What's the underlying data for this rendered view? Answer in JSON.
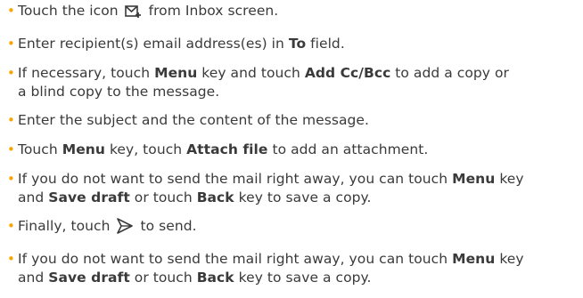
{
  "colors": {
    "bullet": "#f7a600",
    "text": "#3a3a3a"
  },
  "icons": {
    "compose": "compose-mail-icon",
    "send": "send-arrow-icon"
  },
  "steps": [
    {
      "a": "Touch the icon",
      "b": "from Inbox screen."
    },
    {
      "a": "Enter recipient(s) email address(es) in",
      "b": "To",
      "c": "field."
    },
    {
      "a": "If necessary, touch",
      "b": "Menu",
      "c": "key and touch",
      "d": "Add Cc/Bcc",
      "e": "to add a copy or",
      "f": "a blind copy to the message."
    },
    {
      "a": "Enter the subject and the content of the message."
    },
    {
      "a": "Touch",
      "b": "Menu",
      "c": "key, touch",
      "d": "Attach file",
      "e": "to add an attachment."
    },
    {
      "a": "If you do not want to send the mail right away, you can touch",
      "b": "Menu",
      "c": "key",
      "d": "and",
      "e": "Save draft",
      "f": "or touch",
      "g": "Back",
      "h": "key to save a copy."
    },
    {
      "a": "Finally, touch",
      "b": "to send."
    },
    {
      "a": "If you do not want to send the mail right away, you can touch",
      "b": "Menu",
      "c": "key",
      "d": "and",
      "e": "Save draft",
      "f": "or touch",
      "g": "Back",
      "h": "key to save a copy."
    }
  ]
}
